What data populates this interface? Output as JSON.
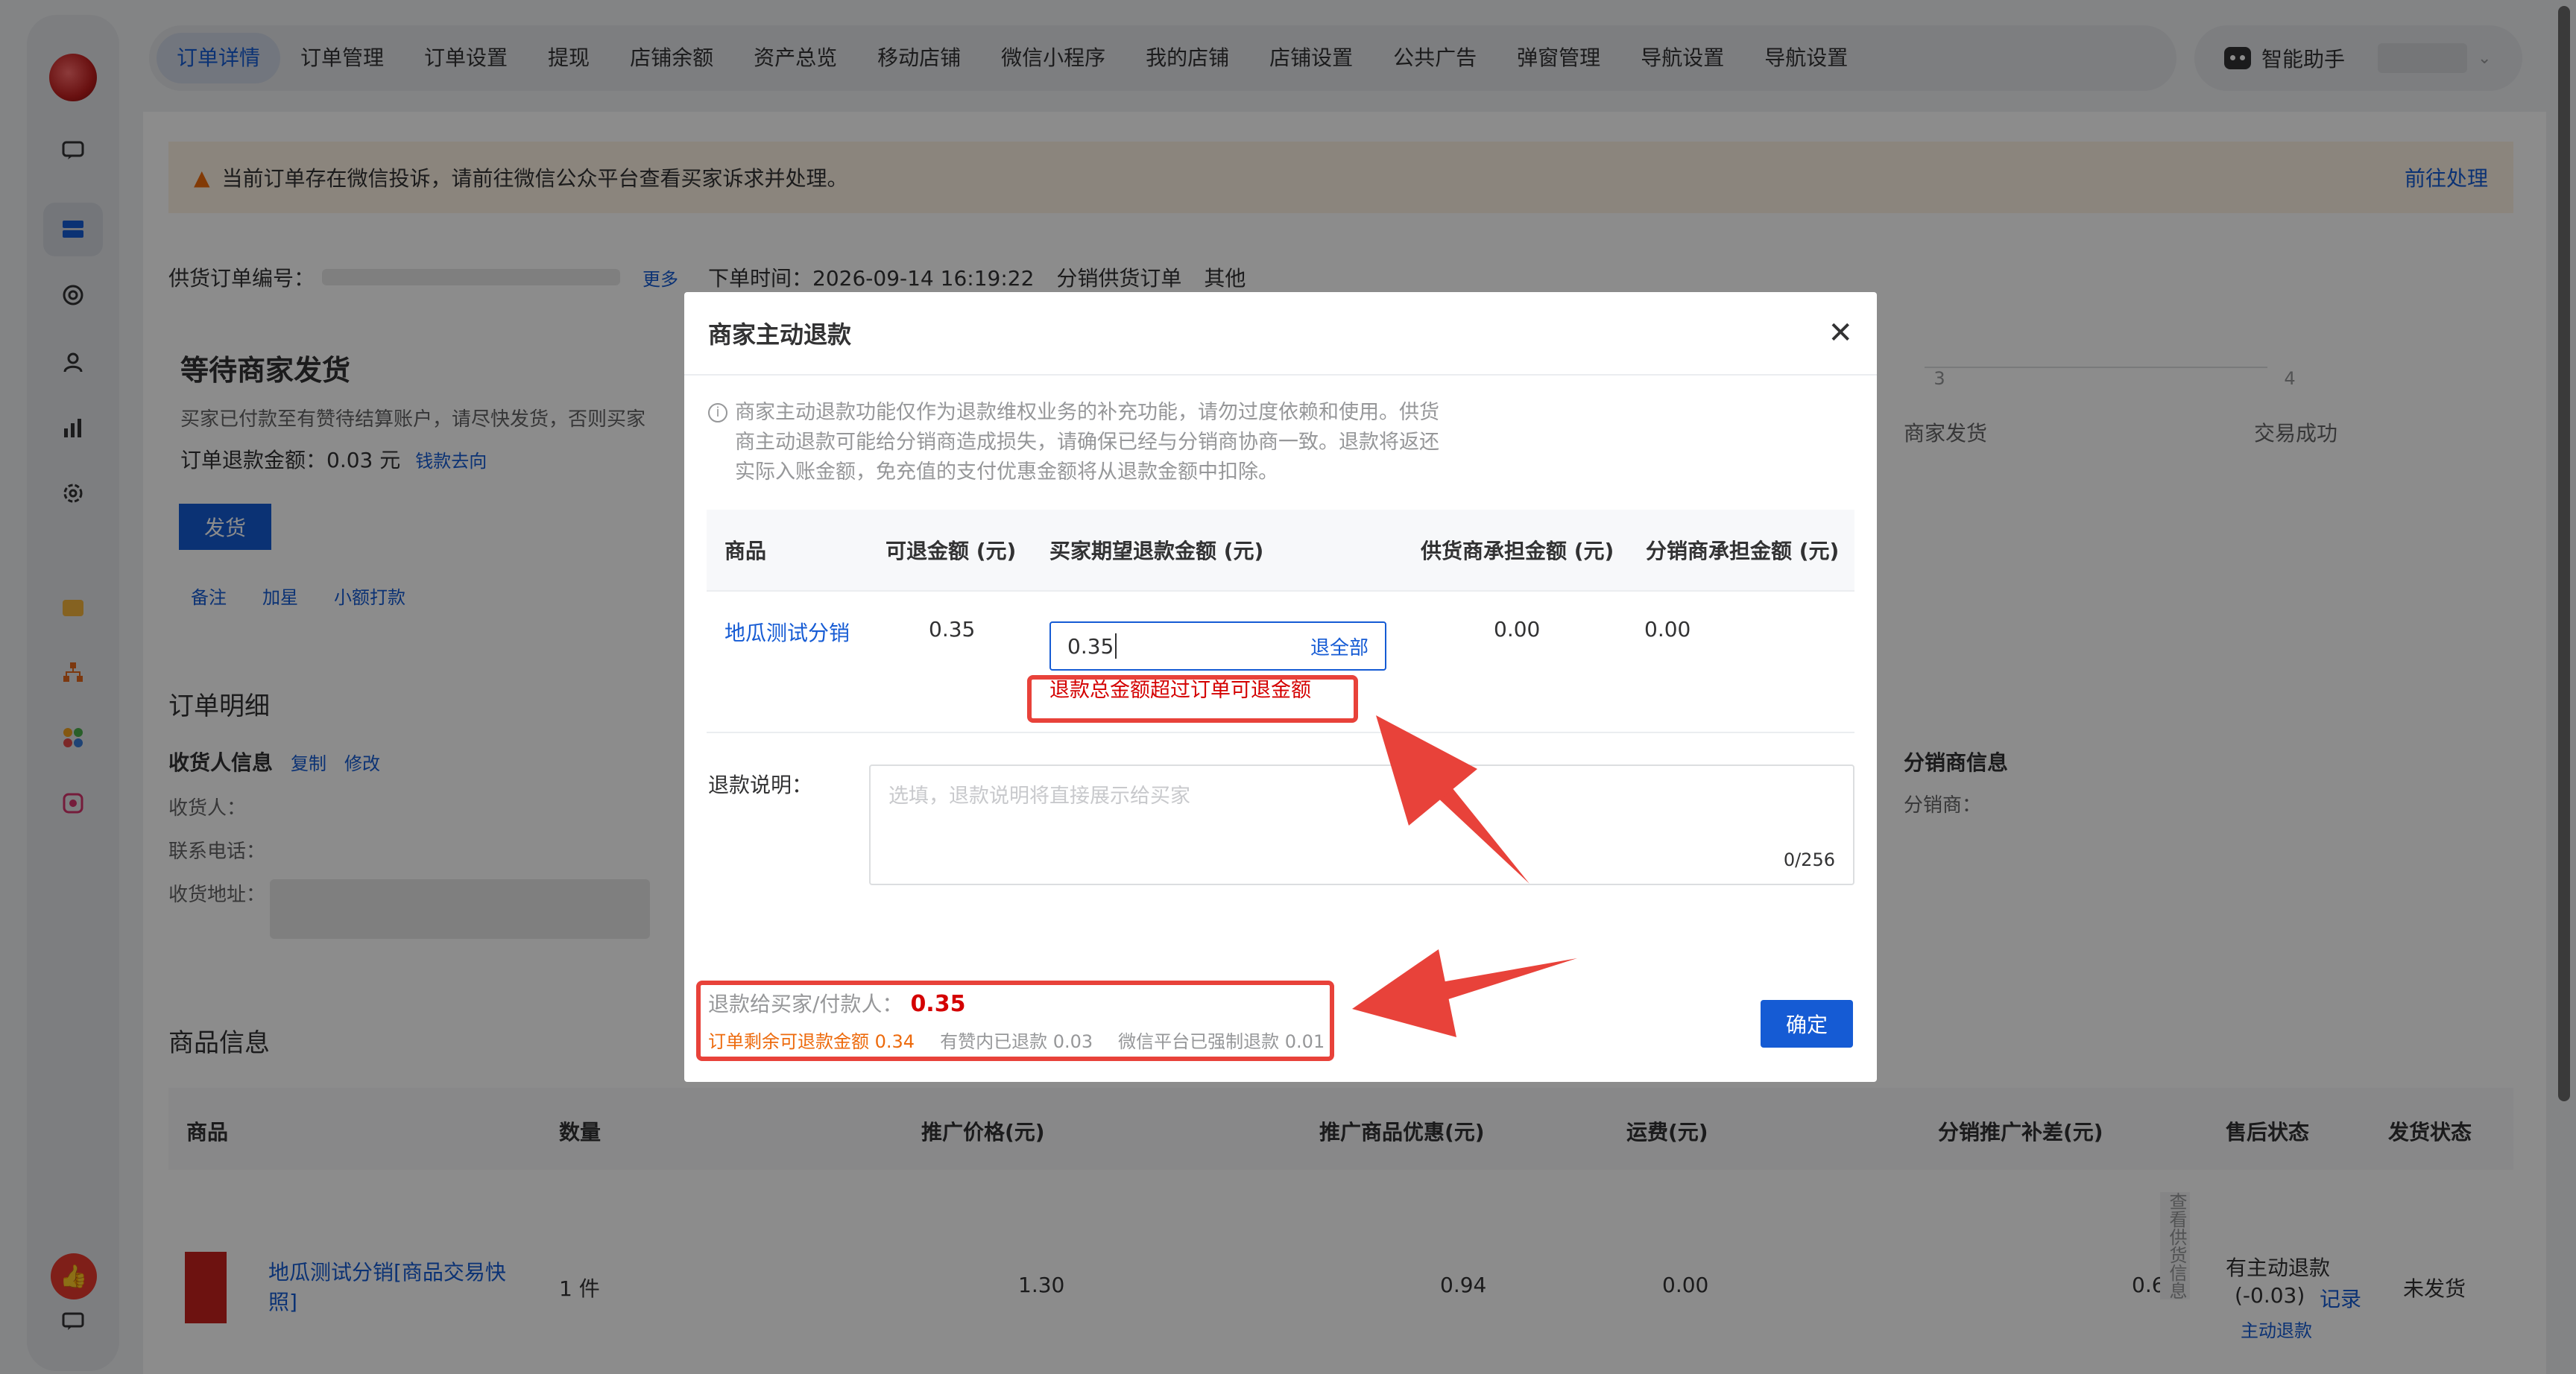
{
  "topnav": {
    "tabs": [
      "订单详情",
      "订单管理",
      "订单设置",
      "提现",
      "店铺余额",
      "资产总览",
      "移动店铺",
      "微信小程序",
      "我的店铺",
      "店铺设置",
      "公共广告",
      "弹窗管理",
      "导航设置",
      "导航设置"
    ],
    "assistant": "智能助手"
  },
  "notice": {
    "text": "当前订单存在微信投诉，请前往微信公众平台查看买家诉求并处理。",
    "action": "前往处理"
  },
  "order": {
    "no_label": "供货订单编号：",
    "more": "更多",
    "time": "下单时间：2026-09-14 16:19:22",
    "type": "分销供货订单",
    "other": "其他",
    "status": "等待商家发货",
    "status_desc": "买家已付款至有赞待结算账户，请尽快发货，否则买家",
    "refund_amount": "订单退款金额：0.03 元",
    "money_flow": "钱款去向",
    "ship_btn": "发货",
    "actions": [
      "备注",
      "加星",
      "小额打款"
    ],
    "steps": [
      {
        "num": "3",
        "label": "商家发货"
      },
      {
        "num": "4",
        "label": "交易成功"
      }
    ]
  },
  "detail": {
    "title": "订单明细",
    "receiver_title": "收货人信息",
    "copy": "复制",
    "modify": "修改",
    "receiver": "收货人：",
    "phone": "联系电话：",
    "address": "收货地址：",
    "dist_title": "分销商信息",
    "dist_label": "分销商："
  },
  "goods": {
    "title": "商品信息",
    "headers": [
      "商品",
      "数量",
      "推广价格(元)",
      "推广商品优惠(元)",
      "运费(元)",
      "分销推广补差(元)",
      "售后状态",
      "发货状态"
    ],
    "row": {
      "name": "地瓜测试分销[商品交易快照]",
      "qty": "1 件",
      "price": "1.30",
      "discount": "0.94",
      "freight": "0.00",
      "diff": "0.64",
      "side": "查看供货信息",
      "aftersale": "有主动退款",
      "aftersale_amt": "(-0.03)",
      "record": "记录",
      "refund_btn": "主动退款",
      "ship_status": "未发货"
    }
  },
  "modal": {
    "title": "商家主动退款",
    "tip": "商家主动退款功能仅作为退款维权业务的补充功能，请勿过度依赖和使用。供货商主动退款可能给分销商造成损失，请确保已经与分销商协商一致。退款将返还实际入账金额，免充值的支付优惠金额将从退款金额中扣除。",
    "table": {
      "headers": [
        "商品",
        "可退金额 (元)",
        "买家期望退款金额 (元)",
        "供货商承担金额 (元)",
        "分销商承担金额 (元)"
      ],
      "product": "地瓜测试分销",
      "refundable": "0.35",
      "input_value": "0.35",
      "refund_all": "退全部",
      "supplier": "0.00",
      "distributor": "0.00",
      "error": "退款总金额超过订单可退金额"
    },
    "desc_label": "退款说明：",
    "desc_placeholder": "选填，退款说明将直接展示给买家",
    "desc_count": "0/256",
    "summary": {
      "label": "退款给买家/付款人：",
      "amount": "0.35",
      "remain": "订单剩余可退款金额 0.34",
      "youzan": "有赞内已退款 0.03",
      "wechat": "微信平台已强制退款 0.01"
    },
    "confirm": "确定"
  },
  "colors": {
    "accent": "#155bd4",
    "error": "#d40000",
    "annotation": "#e8423a",
    "warning": "#ed6a0c"
  }
}
